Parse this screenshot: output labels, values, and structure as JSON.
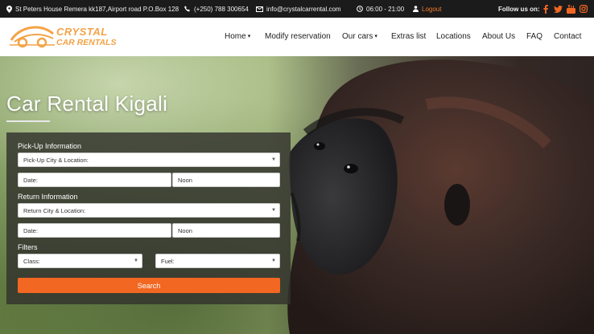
{
  "topbar": {
    "address": "St Peters House Remera kk187,Airport road P.O.Box 128",
    "phone": "(+250) 788 300654",
    "email": "info@crystalcarrental.com",
    "hours": "06:00 - 21:00",
    "logout": "Logout",
    "follow": "Follow us on:",
    "social": [
      "facebook-icon",
      "twitter-icon",
      "youtube-icon",
      "instagram-icon"
    ]
  },
  "logo": {
    "line1": "CRYSTAL",
    "line2": "CAR RENTALS"
  },
  "nav": {
    "items": [
      "Home",
      "Modify reservation",
      "Our cars",
      "Extras list",
      "Locations",
      "About Us",
      "FAQ",
      "Contact"
    ]
  },
  "hero": {
    "title": "Car Rental Kigali"
  },
  "form": {
    "pickup_label": "Pick-Up Information",
    "pickup_location": "Pick-Up City & Location:",
    "pickup_date": "Date:",
    "pickup_time": "Noon",
    "return_label": "Return Information",
    "return_location": "Return City & Location:",
    "return_date": "Date:",
    "return_time": "Noon",
    "filters_label": "Filters",
    "class": "Class:",
    "fuel": "Fuel:",
    "search": "Search"
  },
  "colors": {
    "accent": "#f26722",
    "logo": "#f4a347",
    "topbar": "#1b1b1b"
  }
}
